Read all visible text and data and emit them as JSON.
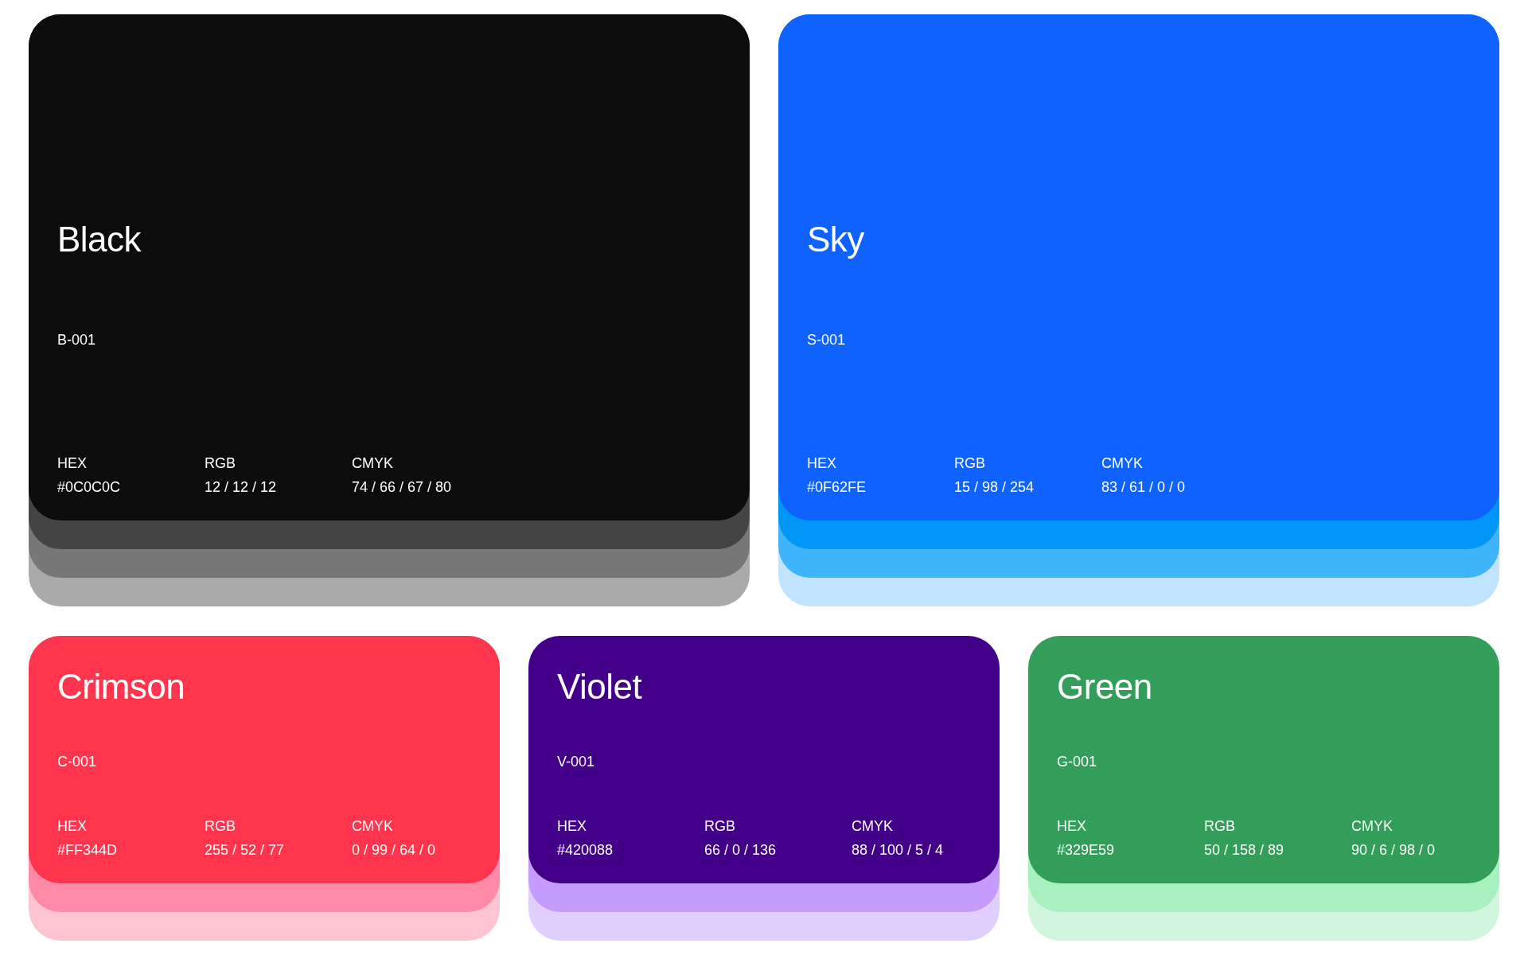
{
  "swatches": [
    {
      "kind": "large",
      "name": "Black",
      "code": "B-001",
      "color": "#0c0c0c",
      "shades": [
        {
          "color": "#444444"
        },
        {
          "color": "#777777"
        },
        {
          "color": "#aaaaaa"
        }
      ],
      "specs": [
        {
          "label": "HEX",
          "value": "#0C0C0C"
        },
        {
          "label": "RGB",
          "value": "12 / 12 / 12"
        },
        {
          "label": "CMYK",
          "value": "74 / 66 / 67 / 80"
        }
      ]
    },
    {
      "kind": "large",
      "name": "Sky",
      "code": "S-001",
      "color": "#0f62fe",
      "shades": [
        {
          "color": "#0096f5"
        },
        {
          "color": "#40b4fb"
        },
        {
          "color": "#c0e4fd"
        }
      ],
      "specs": [
        {
          "label": "HEX",
          "value": "#0F62FE"
        },
        {
          "label": "RGB",
          "value": "15 / 98 / 254"
        },
        {
          "label": "CMYK",
          "value": "83 / 61 / 0 / 0"
        }
      ]
    },
    {
      "kind": "small",
      "name": "Crimson",
      "code": "C-001",
      "color": "#ff344d",
      "shades": [
        {
          "color": "#ff8aa8"
        },
        {
          "color": "#ffc4d2"
        }
      ],
      "specs": [
        {
          "label": "HEX",
          "value": "#FF344D"
        },
        {
          "label": "RGB",
          "value": "255 / 52 / 77"
        },
        {
          "label": "CMYK",
          "value": "0 / 99 / 64 / 0"
        }
      ]
    },
    {
      "kind": "small",
      "name": "Violet",
      "code": "V-001",
      "color": "#420088",
      "shades": [
        {
          "color": "#c59cfc"
        },
        {
          "color": "#e0cefc"
        }
      ],
      "specs": [
        {
          "label": "HEX",
          "value": "#420088"
        },
        {
          "label": "RGB",
          "value": "66 / 0 / 136"
        },
        {
          "label": "CMYK",
          "value": "88 / 100 / 5 / 4"
        }
      ]
    },
    {
      "kind": "small",
      "name": "Green",
      "code": "G-001",
      "color": "#329e59",
      "shades": [
        {
          "color": "#a8f0bd"
        },
        {
          "color": "#d2f5dd"
        }
      ],
      "specs": [
        {
          "label": "HEX",
          "value": "#329E59"
        },
        {
          "label": "RGB",
          "value": "50 / 158 / 89"
        },
        {
          "label": "CMYK",
          "value": "90 / 6 / 98 / 0"
        }
      ]
    }
  ]
}
